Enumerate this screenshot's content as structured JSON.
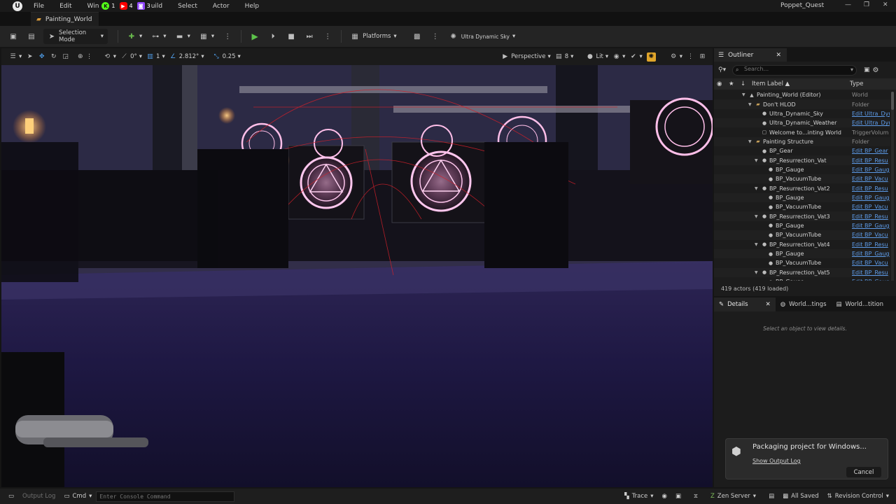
{
  "menubar": {
    "logo": "U",
    "items": [
      "File",
      "Edit",
      "Win",
      "uild",
      "Select",
      "Actor",
      "Help"
    ],
    "overlay_badges": [
      {
        "icon": "kick-icon",
        "color": "#53fc18",
        "count": "1"
      },
      {
        "icon": "youtube-icon",
        "color": "#ff0000",
        "count": "4"
      },
      {
        "icon": "twitch-icon",
        "color": "#9146ff",
        "count": "3"
      }
    ],
    "app_title": "Poppet_Quest",
    "window_controls": {
      "minimize": "—",
      "restore": "❐",
      "close": "✕"
    }
  },
  "level_tab": {
    "label": "Painting_World"
  },
  "toolbar": {
    "mode_label": "Selection Mode",
    "platforms_label": "Platforms",
    "sky_label": "Ultra Dynamic Sky"
  },
  "viewport_toolbar": {
    "rotate_snap": "0°",
    "grid_snap": "1",
    "angle_value": "2.812°",
    "scale_value": "0.25",
    "view_mode": "Perspective",
    "camera_speed": "8",
    "lit_label": "Lit"
  },
  "outliner": {
    "tab_label": "Outliner",
    "search_placeholder": "Search...",
    "col_label": "Item Label ▲",
    "col_type": "Type",
    "rows": [
      {
        "label": "Painting_World (Editor)",
        "type": "World",
        "link": false,
        "depth": 0,
        "kind": "world"
      },
      {
        "label": "Don't HLOD",
        "type": "Folder",
        "link": false,
        "depth": 1,
        "kind": "folder"
      },
      {
        "label": "Ultra_Dynamic_Sky",
        "type": "Edit Ultra_Dyn",
        "link": true,
        "depth": 2,
        "kind": "actor"
      },
      {
        "label": "Ultra_Dynamic_Weather",
        "type": "Edit Ultra_Dyn",
        "link": true,
        "depth": 2,
        "kind": "actor"
      },
      {
        "label": "Welcome to...inting World",
        "type": "TriggerVolum",
        "link": false,
        "depth": 2,
        "kind": "trigger"
      },
      {
        "label": "Painting Structure",
        "type": "Folder",
        "link": false,
        "depth": 1,
        "kind": "folder"
      },
      {
        "label": "BP_Gear",
        "type": "Edit BP_Gear",
        "link": true,
        "depth": 2,
        "kind": "actor"
      },
      {
        "label": "BP_Resurrection_Vat",
        "type": "Edit BP_Resu",
        "link": true,
        "depth": 2,
        "kind": "parent"
      },
      {
        "label": "BP_Gauge",
        "type": "Edit BP_Gaug",
        "link": true,
        "depth": 3,
        "kind": "actor"
      },
      {
        "label": "BP_VacuumTube",
        "type": "Edit BP_Vacu",
        "link": true,
        "depth": 3,
        "kind": "actor"
      },
      {
        "label": "BP_Resurrection_Vat2",
        "type": "Edit BP_Resu",
        "link": true,
        "depth": 2,
        "kind": "parent"
      },
      {
        "label": "BP_Gauge",
        "type": "Edit BP_Gaug",
        "link": true,
        "depth": 3,
        "kind": "actor"
      },
      {
        "label": "BP_VacuumTube",
        "type": "Edit BP_Vacu",
        "link": true,
        "depth": 3,
        "kind": "actor"
      },
      {
        "label": "BP_Resurrection_Vat3",
        "type": "Edit BP_Resu",
        "link": true,
        "depth": 2,
        "kind": "parent"
      },
      {
        "label": "BP_Gauge",
        "type": "Edit BP_Gaug",
        "link": true,
        "depth": 3,
        "kind": "actor"
      },
      {
        "label": "BP_VacuumTube",
        "type": "Edit BP_Vacu",
        "link": true,
        "depth": 3,
        "kind": "actor"
      },
      {
        "label": "BP_Resurrection_Vat4",
        "type": "Edit BP_Resu",
        "link": true,
        "depth": 2,
        "kind": "parent"
      },
      {
        "label": "BP_Gauge",
        "type": "Edit BP_Gaug",
        "link": true,
        "depth": 3,
        "kind": "actor"
      },
      {
        "label": "BP_VacuumTube",
        "type": "Edit BP_Vacu",
        "link": true,
        "depth": 3,
        "kind": "actor"
      },
      {
        "label": "BP_Resurrection_Vat5",
        "type": "Edit BP_Resu",
        "link": true,
        "depth": 2,
        "kind": "parent"
      },
      {
        "label": "BP_Gauge",
        "type": "Edit BP_Gaug",
        "link": true,
        "depth": 3,
        "kind": "actor"
      }
    ],
    "actor_count": "419 actors (419 loaded)"
  },
  "details": {
    "tabs": [
      "Details",
      "World...tings",
      "World...tition"
    ],
    "empty_text": "Select an object to view details."
  },
  "notification": {
    "title": "Packaging project for Windows...",
    "link": "Show Output Log",
    "cancel_label": "Cancel"
  },
  "statusbar": {
    "output_log": "Output Log",
    "cmd_label": "Cmd",
    "console_placeholder": "Enter Console Command",
    "trace_label": "Trace",
    "zen_label": "Zen Server",
    "saved_label": "All Saved",
    "revision_label": "Revision Control"
  }
}
